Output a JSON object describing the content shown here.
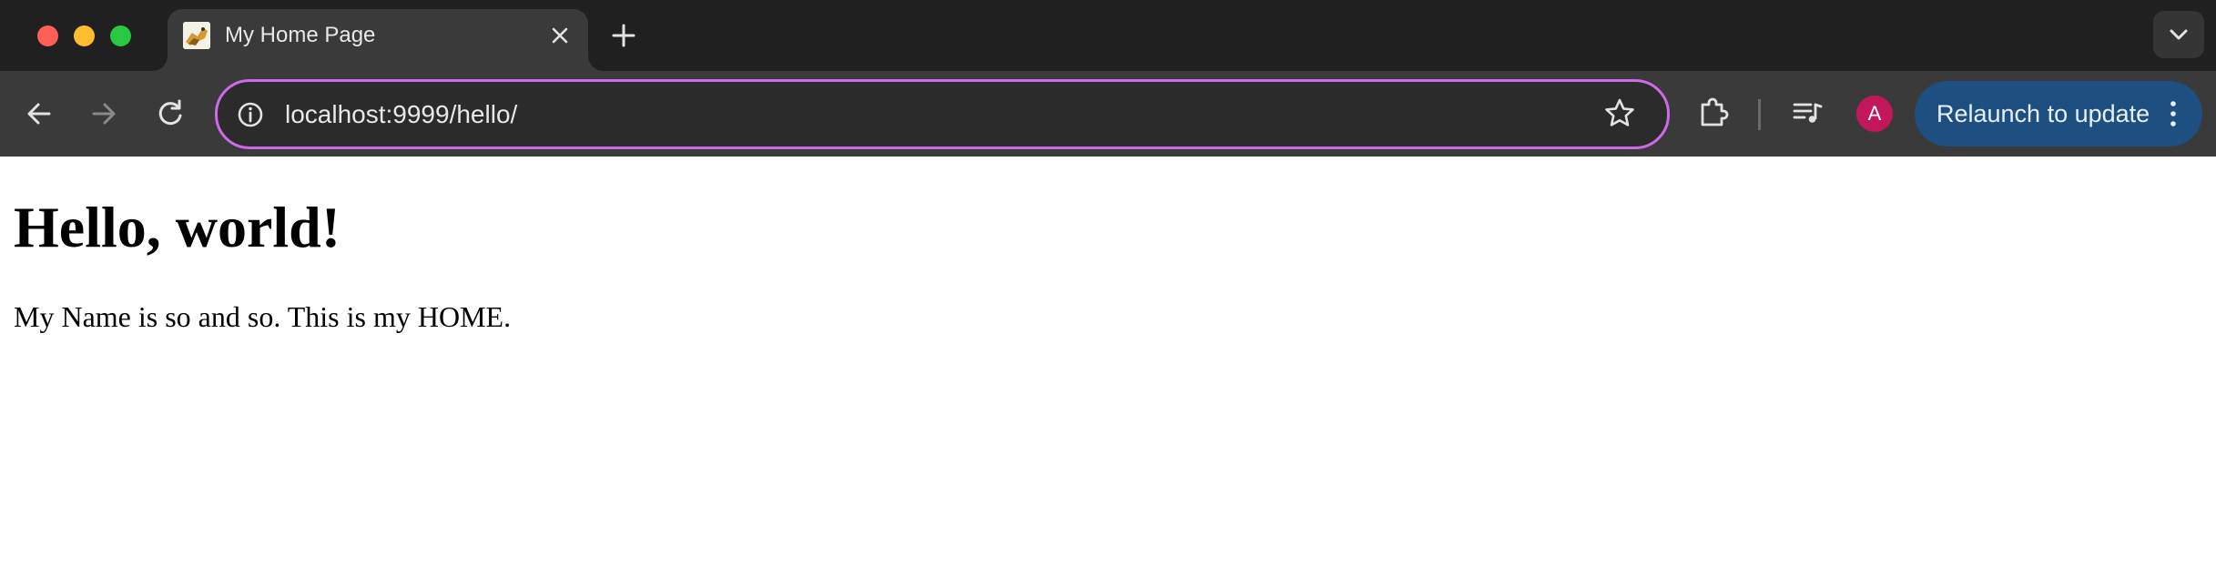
{
  "window": {
    "tabs": [
      {
        "title": "My Home Page",
        "active": true
      }
    ]
  },
  "toolbar": {
    "url": "localhost:9999/hello/",
    "profile_initial": "A",
    "relaunch_label": "Relaunch to update"
  },
  "page": {
    "heading": "Hello, world!",
    "paragraph": "My Name is so and so. This is my HOME."
  },
  "colors": {
    "omnibox_focus_ring": "#d068ea",
    "relaunch_button": "#1d4f80",
    "avatar": "#c2185b"
  },
  "icons": [
    "close-window",
    "minimize-window",
    "maximize-window",
    "favicon",
    "close-tab",
    "new-tab",
    "tab-search",
    "back",
    "forward",
    "reload",
    "site-info",
    "bookmark-star",
    "extensions",
    "media-controls",
    "kebab-menu"
  ]
}
